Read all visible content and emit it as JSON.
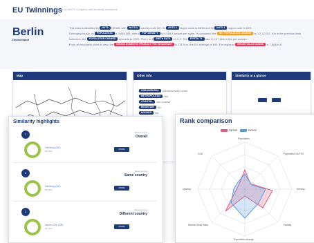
{
  "header": {
    "brand": "EU Twinnings",
    "note": "Based on NUTS 3 regions and similarity measures"
  },
  "city": {
    "name": "Berlin",
    "country": "Deutschland"
  },
  "description": {
    "line1_pre": "This area is identified by",
    "line1_mid": "DE300, with",
    "line1_mid2": "country code DE. Its",
    "line1_mid3": "region code is DE30 and its",
    "line1_end": "region code is DE3.",
    "line2_pre": "Demographically, its",
    "line2_mid": "is 3,664,088, with a",
    "line2_mid2": "of 4,088.4 people per sqkm. If compared, the",
    "line2_end": "is 0.2 1/2 2/2. It is in the previous data",
    "line3_pre": "collection, the",
    "line3_mid": "amounts to 2020. There is a",
    "line3_mid2": "of -0.2. The",
    "line3_end": "rate is 1.47 kids in the per woman.",
    "line4_pre": "From an economic point of view, the",
    "line4_mid": "is 124.5 vs. the EU average of 100. The regional",
    "line4_end": "is 7,80584 €."
  },
  "pills": {
    "p1": "NUTS",
    "p2": "NUTS 0",
    "p3": "NUTS 2",
    "p4": "NUTS 1",
    "p5": "POPULATION",
    "p6": "POP DENSITY",
    "p7": "NET POPULATION CHANGE",
    "p8": "POPULATION CHANGE",
    "p9": "BIRTH RATE",
    "p10": "FERTILITY",
    "p11": "GROSS DOMESTIC PRODUCT PER INHABITANT",
    "p12": "GROSS VALUE ADDED"
  },
  "panels": {
    "map": "Map",
    "info": "Other info",
    "similarity": "Similarity at a glance"
  },
  "info_rows": [
    {
      "tag": "URBAN/RURAL",
      "text": "predominantly urban"
    },
    {
      "tag": "METROPOLITAN",
      "text": "Yes"
    },
    {
      "tag": "COASTAL",
      "text": "non-coastal"
    },
    {
      "tag": "MOUNTAIN",
      "text": "No"
    },
    {
      "tag": "BORDER",
      "text": "No"
    },
    {
      "tag": "ISLAND",
      "text": "No"
    }
  ],
  "info_extra": [
    "CLUSTERS",
    "NATIONAL",
    "HOT SPOTS",
    "WATER",
    "LOCAL"
  ],
  "similarity": {
    "title": "Similarity highlights",
    "cards": [
      {
        "num": "1",
        "type": "Measure type",
        "title": "Overall",
        "city": "Hamburg (DE)",
        "pct": "98.43%",
        "btn": "MORE"
      },
      {
        "num": "2",
        "type": "Measure type",
        "title": "Same country",
        "city": "Hamburg (DE)",
        "pct": "98.43%",
        "btn": "MORE"
      },
      {
        "num": "3",
        "type": "Measure type",
        "title": "Different country",
        "city": "Athens City (GR)",
        "pct": "94.17%",
        "btn": "MORE"
      }
    ]
  },
  "rank": {
    "title": "Rank comparison",
    "legend": [
      {
        "name": "DE300",
        "color": "#e05b7d"
      },
      {
        "name": "DE300",
        "color": "#5a9be0"
      }
    ],
    "axes": [
      "Population",
      "Population NUTS3",
      "Density",
      "Fertility",
      "Population change",
      "Worried Mad Ratio",
      "Upkeep",
      "GVA"
    ]
  },
  "colors": {
    "primary": "#1f3a7a",
    "ring": "#9bc34a",
    "series_a": "#e05b7d",
    "series_b": "#5a9be0"
  }
}
